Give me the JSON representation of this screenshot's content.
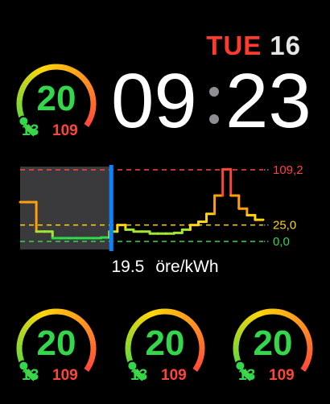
{
  "date": {
    "weekday": "TUE",
    "day": "16"
  },
  "time": {
    "hours": "09",
    "minutes": "23"
  },
  "gauges": [
    {
      "value": "20",
      "min": "13",
      "max": "109"
    },
    {
      "value": "20",
      "min": "13",
      "max": "109"
    },
    {
      "value": "20",
      "min": "13",
      "max": "109"
    },
    {
      "value": "20",
      "min": "13",
      "max": "109"
    }
  ],
  "gauge_fraction": 0.1,
  "price": {
    "value": "19.5",
    "unit": "öre/kWh"
  },
  "chart_data": {
    "type": "line",
    "title": "",
    "xlabel": "",
    "ylabel": "",
    "ylim": [
      0,
      109.2
    ],
    "reference_lines": [
      {
        "label": "109,2",
        "value": 109.2,
        "color": "#ff453a"
      },
      {
        "label": "25,0",
        "value": 25.0,
        "color": "#ffd60a"
      },
      {
        "label": "0,0",
        "value": 0.0,
        "color": "#32d74b"
      }
    ],
    "current_index": 11,
    "series": [
      {
        "values": [
          60,
          60,
          15,
          15,
          5,
          5,
          5,
          5,
          5,
          5,
          6,
          15,
          25,
          18,
          15,
          15,
          12,
          12,
          12,
          13,
          18,
          25,
          30,
          42,
          70,
          110,
          70,
          50,
          40,
          33
        ]
      }
    ]
  }
}
